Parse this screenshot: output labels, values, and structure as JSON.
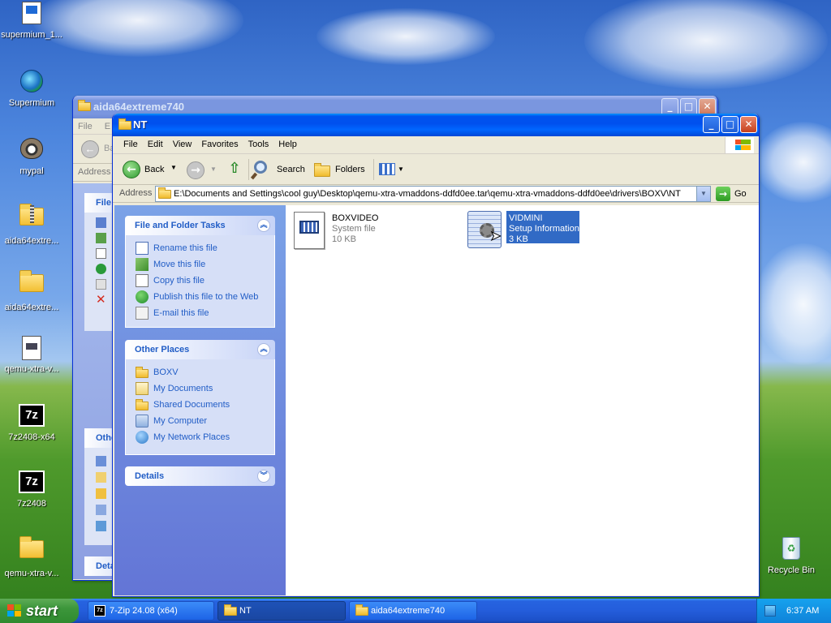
{
  "desktop": {
    "icons": [
      {
        "label": "supermium_1..."
      },
      {
        "label": "Supermium"
      },
      {
        "label": "mypal"
      },
      {
        "label": "aida64extre..."
      },
      {
        "label": "aida64extre..."
      },
      {
        "label": "qemu-xtra-v..."
      },
      {
        "label": "7z2408-x64"
      },
      {
        "label": "7z2408"
      },
      {
        "label": "qemu-xtra-v..."
      },
      {
        "label": "Recycle Bin"
      }
    ],
    "icon_glyph_7z": "7z"
  },
  "back_window": {
    "title": "aida64extreme740",
    "menu_file": "File",
    "menu_edit": "E",
    "back_label": "Ba",
    "address_label": "Address",
    "panel1_title": "File",
    "panel2_title": "Othe",
    "panel3_title": "Deta"
  },
  "window": {
    "title": "NT",
    "menu": [
      "File",
      "Edit",
      "View",
      "Favorites",
      "Tools",
      "Help"
    ],
    "toolbar": {
      "back": "Back",
      "search": "Search",
      "folders": "Folders"
    },
    "address": {
      "label": "Address",
      "value": "E:\\Documents and Settings\\cool guy\\Desktop\\qemu-xtra-vmaddons-ddfd0ee.tar\\qemu-xtra-vmaddons-ddfd0ee\\drivers\\BOXV\\NT",
      "go": "Go"
    },
    "tasks_panel": {
      "title": "File and Folder Tasks",
      "items": [
        "Rename this file",
        "Move this file",
        "Copy this file",
        "Publish this file to the Web",
        "E-mail this file"
      ]
    },
    "places_panel": {
      "title": "Other Places",
      "items": [
        "BOXV",
        "My Documents",
        "Shared Documents",
        "My Computer",
        "My Network Places"
      ]
    },
    "details_panel": {
      "title": "Details"
    },
    "files": [
      {
        "name": "BOXVIDEO",
        "type": "System file",
        "size": "10 KB",
        "selected": false
      },
      {
        "name": "VIDMINI",
        "type": "Setup Information",
        "size": "3 KB",
        "selected": true
      }
    ]
  },
  "taskbar": {
    "start": "start",
    "tasks": [
      "7-Zip 24.08 (x64)",
      "NT",
      "aida64extreme740"
    ],
    "clock": "6:37 AM"
  },
  "colors": {
    "title_active": "#0053ee",
    "task_link": "#215dc6",
    "selection": "#316ac5",
    "start_green": "#3c963b"
  }
}
